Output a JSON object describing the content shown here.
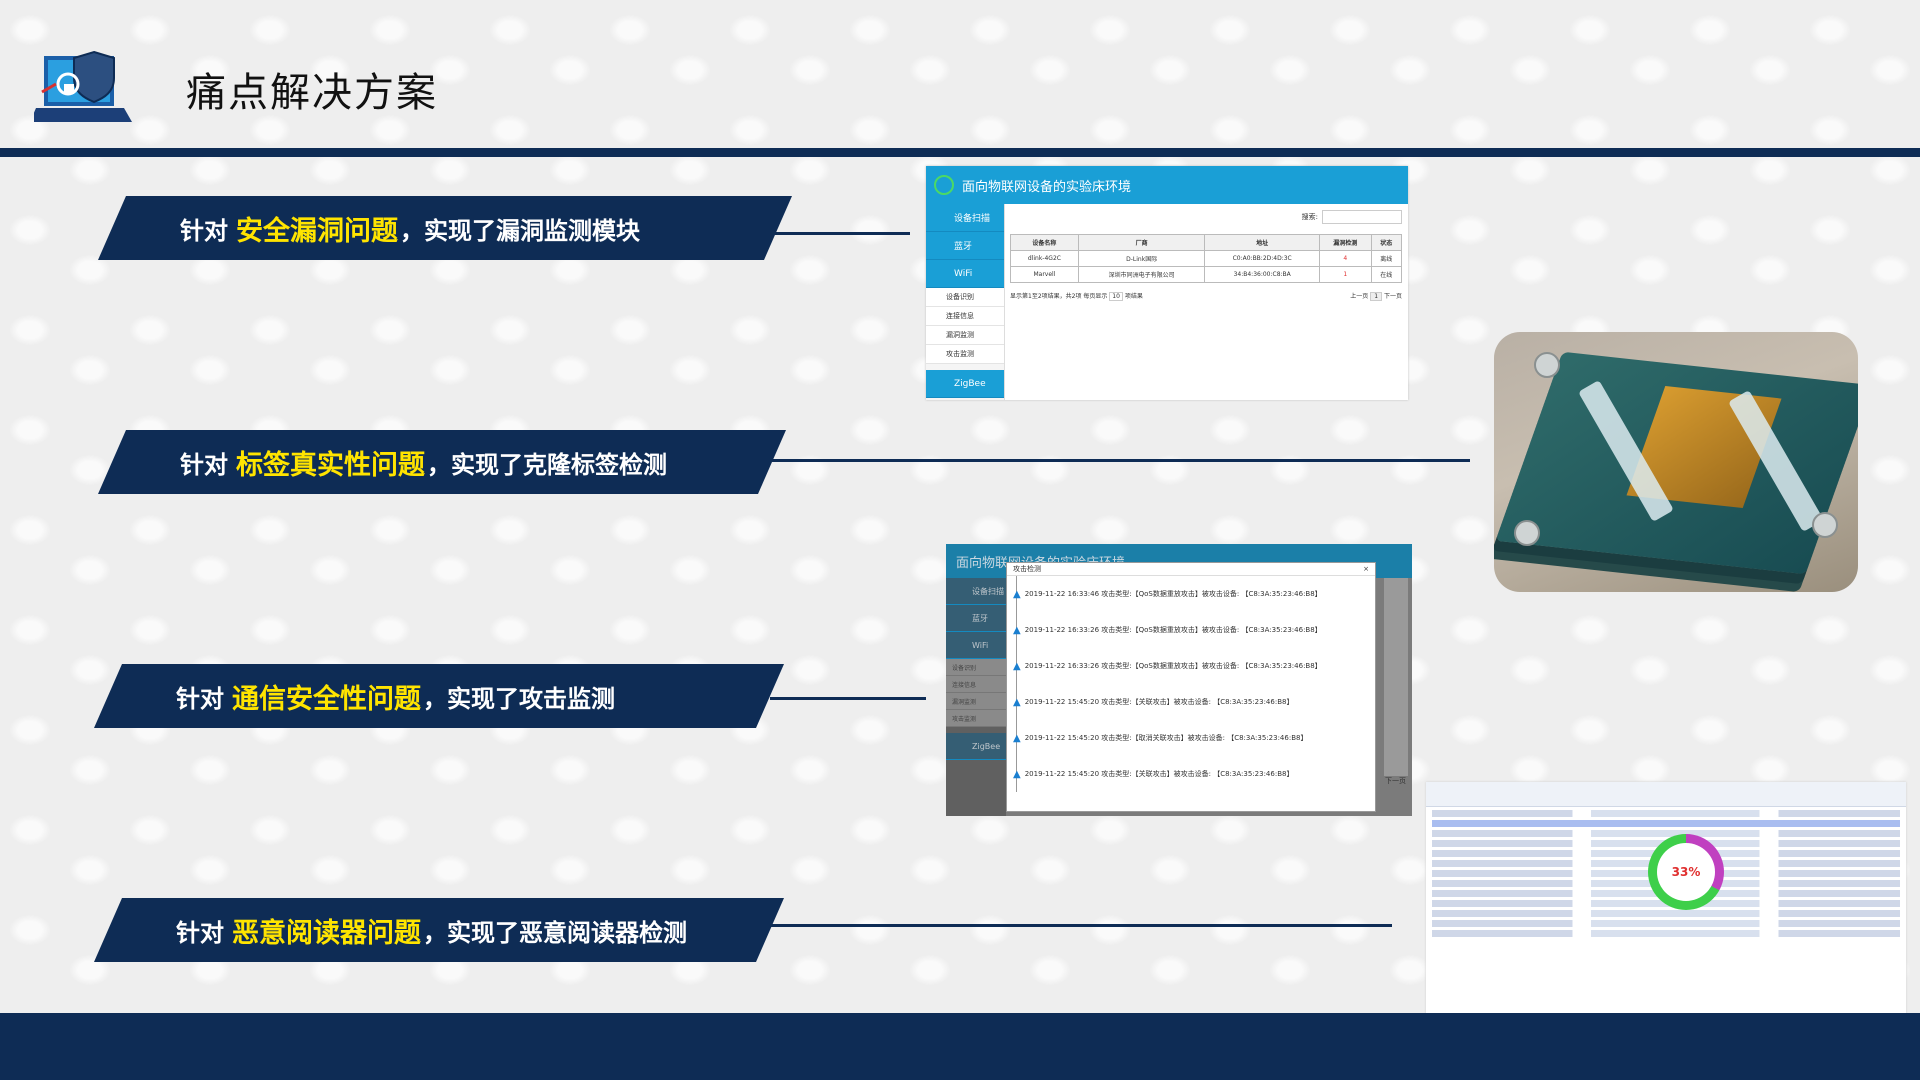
{
  "slide": {
    "title": "痛点解决方案",
    "logo_icon": "laptop-shield-icon"
  },
  "banners": [
    {
      "prefix": "针对",
      "highlight": "安全漏洞问题",
      "suffix": "，实现了漏洞监测模块"
    },
    {
      "prefix": "针对",
      "highlight": "标签真实性问题",
      "suffix": "，实现了克隆标签检测"
    },
    {
      "prefix": "针对",
      "highlight": "通信安全性问题",
      "suffix": "，实现了攻击监测"
    },
    {
      "prefix": "针对",
      "highlight": "恶意阅读器问题",
      "suffix": "，实现了恶意阅读器检测"
    }
  ],
  "screenshot1": {
    "app_title": "面向物联网设备的实验床环境",
    "nav": [
      "设备扫描",
      "蓝牙",
      "WiFi"
    ],
    "sub_nav": [
      "设备识别",
      "连接信息",
      "漏洞监测",
      "攻击监测"
    ],
    "nav_zigbee": "ZigBee",
    "search_label": "搜索:",
    "columns": [
      "设备名称",
      "厂商",
      "地址",
      "漏洞检测",
      "状态"
    ],
    "rows": [
      [
        "dlink-4G2C",
        "D-Link国际",
        "C0:A0:BB:2D:4D:3C",
        "4",
        "离线"
      ],
      [
        "Marvell",
        "深圳市同洲电子有限公司",
        "34:B4:36:00:C8:BA",
        "1",
        "在线"
      ]
    ],
    "footer_info": "显示第1至2项结果，共2项  每页显示",
    "page_size": "10",
    "footer_suffix": "项结果",
    "prev": "上一页",
    "page": "1",
    "next": "下一页"
  },
  "screenshot2": {
    "app_title": "面向物联网设备的实验床环境",
    "dialog_title": "攻击检测",
    "events": [
      "2019-11-22 16:33:46 攻击类型:【QoS数据重放攻击】被攻击设备: 【C8:3A:35:23:46:B8】",
      "2019-11-22 16:33:26 攻击类型:【QoS数据重放攻击】被攻击设备: 【C8:3A:35:23:46:B8】",
      "2019-11-22 16:33:26 攻击类型:【QoS数据重放攻击】被攻击设备: 【C8:3A:35:23:46:B8】",
      "2019-11-22 15:45:20 攻击类型:【关联攻击】被攻击设备: 【C8:3A:35:23:46:B8】",
      "2019-11-22 15:45:20 攻击类型:【取消关联攻击】被攻击设备: 【C8:3A:35:23:46:B8】",
      "2019-11-22 15:45:20 攻击类型:【关联攻击】被攻击设备: 【C8:3A:35:23:46:B8】"
    ],
    "side_nav": [
      "设备扫描",
      "蓝牙",
      "WiFi"
    ],
    "side_sub": [
      "设备识别",
      "连接信息",
      "漏洞监测",
      "攻击监测"
    ],
    "zigbee": "ZigBee",
    "next": "下一页"
  },
  "screenshot3": {
    "progress_label": "33%",
    "progress_fraction": 0.33
  }
}
